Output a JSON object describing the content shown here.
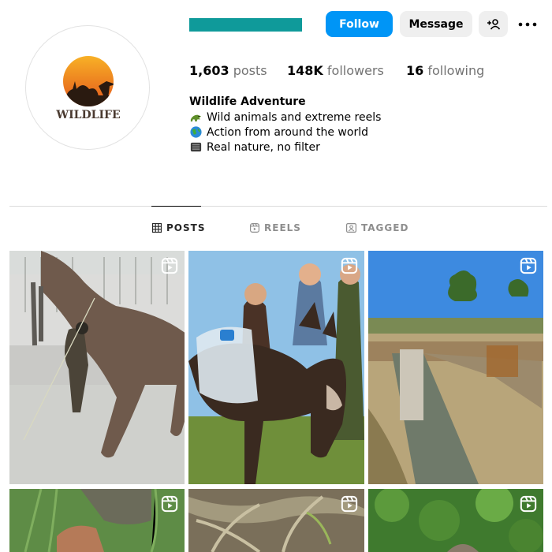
{
  "profile": {
    "username_redacted": true,
    "avatar_text": "WILDLIFE",
    "follow_label": "Follow",
    "message_label": "Message",
    "stats": {
      "posts_count": "1,603",
      "posts_label": "posts",
      "followers_count": "148K",
      "followers_label": "followers",
      "following_count": "16",
      "following_label": "following"
    },
    "bio": {
      "name": "Wildlife Adventure",
      "lines": [
        {
          "text": "Wild animals and extreme reels",
          "icon": "crocodile-emoji"
        },
        {
          "text": "Action from around the world",
          "icon": "globe-emoji"
        },
        {
          "text": "Real nature, no filter",
          "icon": "camera-emoji"
        }
      ]
    }
  },
  "tabs": [
    {
      "label": "POSTS",
      "icon": "grid-icon",
      "active": true
    },
    {
      "label": "REELS",
      "icon": "reels-icon",
      "active": false
    },
    {
      "label": "TAGGED",
      "icon": "tagged-icon",
      "active": false
    }
  ],
  "posts": [
    {
      "kind": "reel",
      "subject": "man-leading-camel"
    },
    {
      "kind": "reel",
      "subject": "people-with-donkey"
    },
    {
      "kind": "reel",
      "subject": "livestock-water-trough"
    },
    {
      "kind": "reel",
      "subject": "hands-in-grass"
    },
    {
      "kind": "reel",
      "subject": "tree-roots"
    },
    {
      "kind": "reel",
      "subject": "green-foliage"
    }
  ],
  "colors": {
    "accent": "#0095f6",
    "username_bar": "#0f9a9a",
    "button_gray": "#efefef",
    "muted_text": "#737373"
  }
}
